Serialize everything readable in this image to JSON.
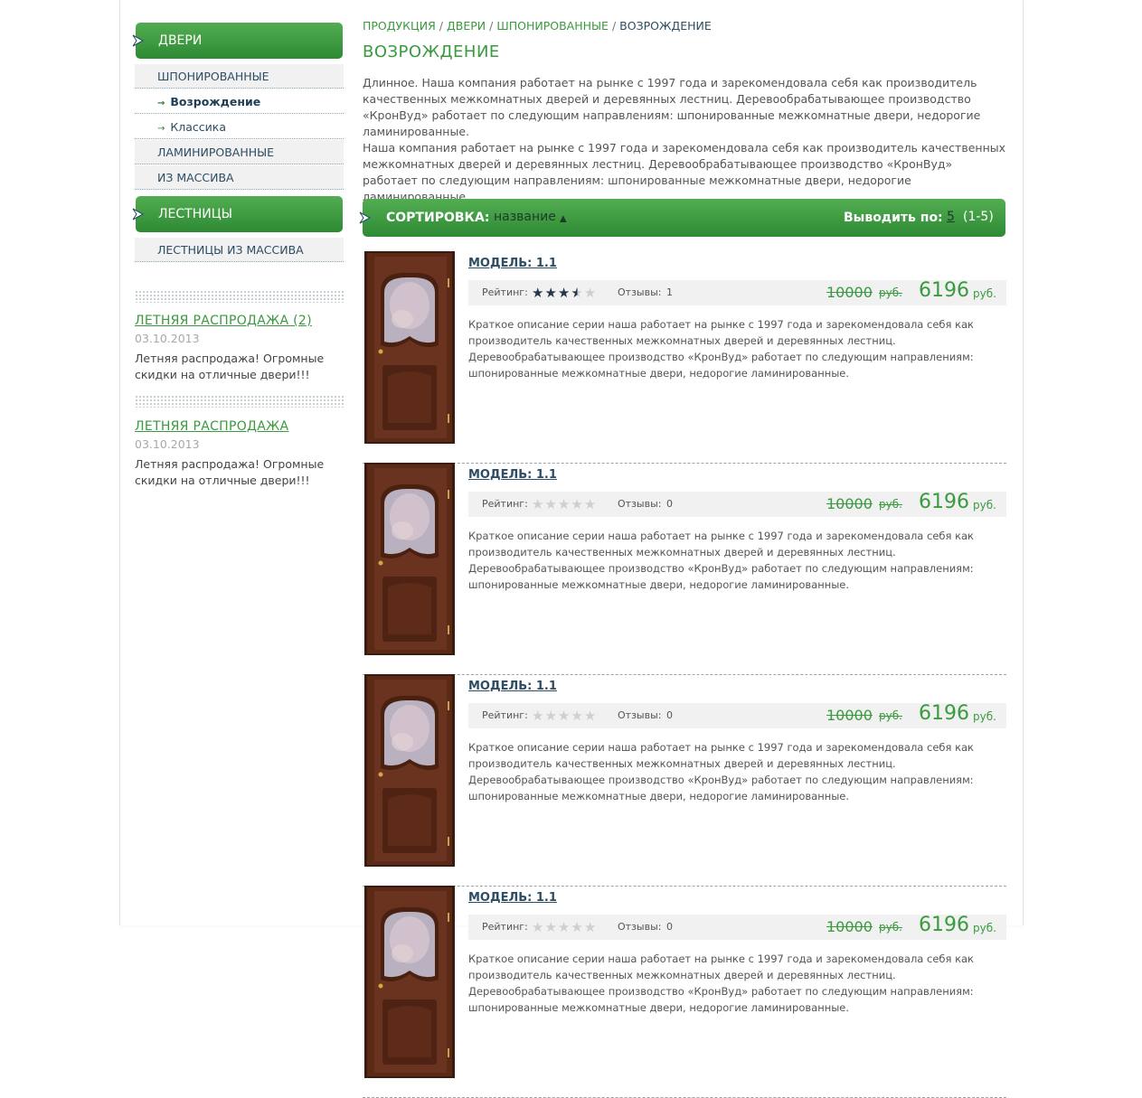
{
  "sidebar": {
    "categories": [
      {
        "label": "ДВЕРИ"
      },
      {
        "label": "ЛЕСТНИЦЫ"
      }
    ],
    "doors_sub": {
      "veneered": "ШПОНИРОВАННЫЕ",
      "vozrozhdenie": "Возрождение",
      "klassika": "Классика",
      "laminated": "ЛАМИНИРОВАННЫЕ",
      "solid": "ИЗ МАССИВА"
    },
    "stairs_sub": {
      "solid": "ЛЕСТНИЦЫ ИЗ МАССИВА"
    },
    "news": [
      {
        "title": "ЛЕТНЯЯ РАСПРОДАЖА (2)",
        "date": "03.10.2013",
        "text": "Летняя распродажа! Огромные скидки на отличные двери!!!"
      },
      {
        "title": "ЛЕТНЯЯ РАСПРОДАЖА",
        "date": "03.10.2013",
        "text": "Летняя распродажа! Огромные скидки на отличные двери!!!"
      }
    ]
  },
  "breadcrumb": {
    "items": [
      "ПРОДУКЦИЯ",
      "ДВЕРИ",
      "ШПОНИРОВАННЫЕ"
    ],
    "current": "ВОЗРОЖДЕНИЕ",
    "separator": "/"
  },
  "page_title": "ВОЗРОЖДЕНИЕ",
  "intro": {
    "p1": "Длинное. Наша компания работает на рынке с 1997 года и зарекомендовала себя как производитель качественных межкомнатных дверей и деревянных лестниц. Деревообрабатывающее производство «КронВуд» работает по следующим направлениям: шпонированные межкомнатные двери, недорогие ламинированные.",
    "p2": "Наша компания работает на рынке с 1997 года и зарекомендовала себя как производитель качественных межкомнатных дверей и деревянных лестниц. Деревообрабатывающее производство «КронВуд» работает по следующим направлениям: шпонированные межкомнатные двери, недорогие ламинированные."
  },
  "sortbar": {
    "sort_label": "СОРТИРОВКА:",
    "sort_value": "название",
    "sort_indicator": "▲",
    "perpage_label": "Выводить по:",
    "perpage_value": "5",
    "range": "(1-5)"
  },
  "products": [
    {
      "model": "МОДЕЛЬ: 1.1",
      "rating_label": "Рейтинг:",
      "rating": 3.5,
      "reviews_label": "Отзывы:",
      "reviews": "1",
      "old_price": "10000",
      "old_currency": "руб.",
      "price": "6196",
      "currency": "руб.",
      "description": "Краткое описание серии наша работает на рынке с 1997 года и зарекомендовала себя как производитель качественных межкомнатных дверей и деревянных лестниц. Деревообрабатывающее производство «КронВуд» работает по следующим направлениям: шпонированные межкомнатные двери, недорогие ламинированные."
    },
    {
      "model": "МОДЕЛЬ: 1.1",
      "rating_label": "Рейтинг:",
      "rating": 0,
      "reviews_label": "Отзывы:",
      "reviews": "0",
      "old_price": "10000",
      "old_currency": "руб.",
      "price": "6196",
      "currency": "руб.",
      "description": "Краткое описание серии наша работает на рынке с 1997 года и зарекомендовала себя как производитель качественных межкомнатных дверей и деревянных лестниц. Деревообрабатывающее производство «КронВуд» работает по следующим направлениям: шпонированные межкомнатные двери, недорогие ламинированные."
    },
    {
      "model": "МОДЕЛЬ: 1.1",
      "rating_label": "Рейтинг:",
      "rating": 0,
      "reviews_label": "Отзывы:",
      "reviews": "0",
      "old_price": "10000",
      "old_currency": "руб.",
      "price": "6196",
      "currency": "руб.",
      "description": "Краткое описание серии наша работает на рынке с 1997 года и зарекомендовала себя как производитель качественных межкомнатных дверей и деревянных лестниц. Деревообрабатывающее производство «КронВуд» работает по следующим направлениям: шпонированные межкомнатные двери, недорогие ламинированные."
    },
    {
      "model": "МОДЕЛЬ: 1.1",
      "rating_label": "Рейтинг:",
      "rating": 0,
      "reviews_label": "Отзывы:",
      "reviews": "0",
      "old_price": "10000",
      "old_currency": "руб.",
      "price": "6196",
      "currency": "руб.",
      "description": "Краткое описание серии наша работает на рынке с 1997 года и зарекомендовала себя как производитель качественных межкомнатных дверей и деревянных лестниц. Деревообрабатывающее производство «КронВуд» работает по следующим направлениям: шпонированные межкомнатные двери, недорогие ламинированные."
    }
  ],
  "colors": {
    "brand_green": "#3a9a3e",
    "header_green_top": "#52ad52",
    "header_green_bottom": "#2e8a33",
    "link_blue": "#2c4d63",
    "star_filled": "#24364a",
    "star_empty": "#cfcfcf",
    "door_wood": "#5b2a17"
  },
  "icons": {
    "category_arrow": "arrow-right-icon",
    "sub_bullet": "arrow-bullet-icon",
    "star": "star-icon"
  }
}
